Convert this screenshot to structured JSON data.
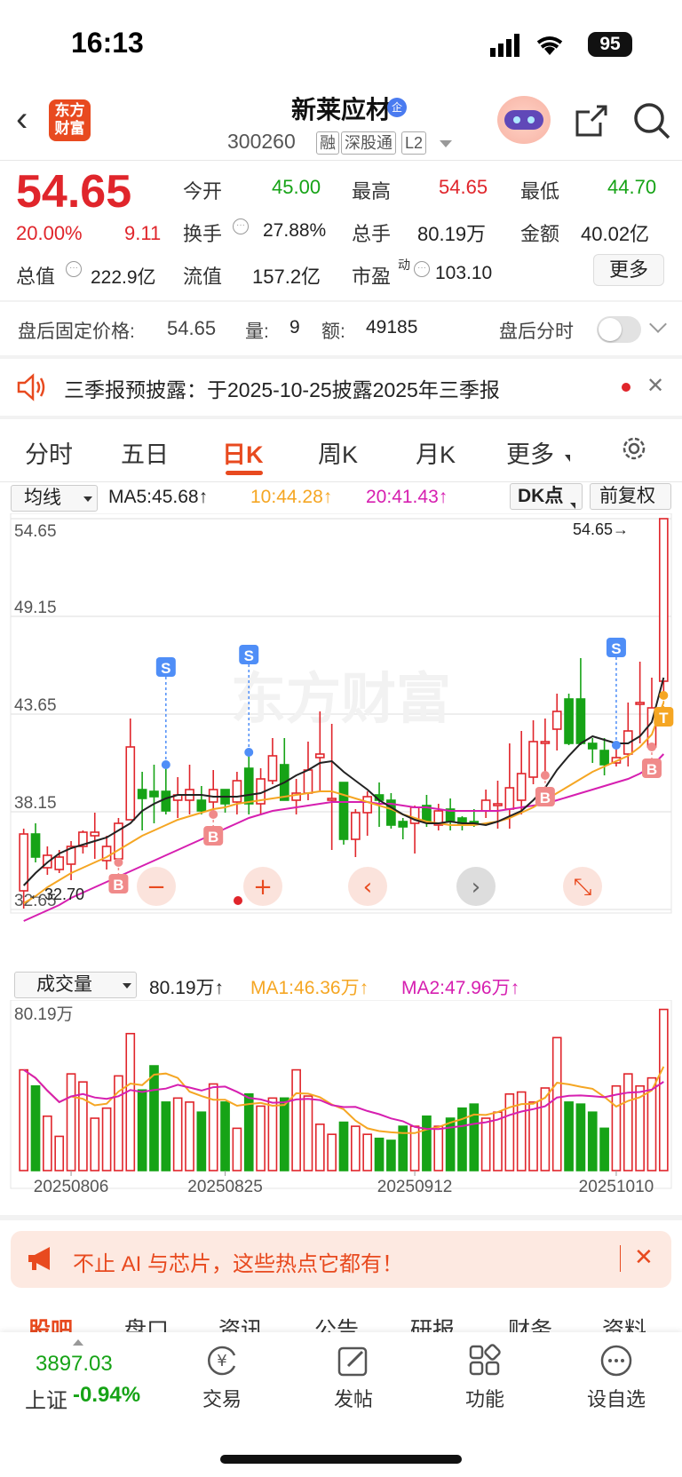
{
  "status": {
    "time": "16:13",
    "battery": "95"
  },
  "header": {
    "logo_line1": "东方",
    "logo_line2": "财富",
    "name": "新莱应材",
    "name_badge": "企",
    "code": "300260",
    "tags": [
      "融",
      "深股通",
      "L2"
    ]
  },
  "quote": {
    "price": "54.65",
    "change_pct": "20.00%",
    "change": "9.11",
    "open_label": "今开",
    "open": "45.00",
    "high_label": "最高",
    "high": "54.65",
    "low_label": "最低",
    "low": "44.70",
    "turnover_label": "换手",
    "turnover": "27.88%",
    "volume_label": "总手",
    "volume": "80.19万",
    "amount_label": "金额",
    "amount": "40.02亿",
    "mktcap_label": "总值",
    "mktcap": "222.9亿",
    "float_label": "流值",
    "float": "157.2亿",
    "pe_label": "市盈",
    "pe_sup": "动",
    "pe": "103.10",
    "more": "更多"
  },
  "afterhours": {
    "label": "盘后固定价格:",
    "price": "54.65",
    "vol_label": "量:",
    "vol": "9",
    "amt_label": "额:",
    "amt": "49185",
    "timeshare_label": "盘后分时"
  },
  "notice": {
    "text": "三季报预披露：于2025-10-25披露2025年三季报"
  },
  "tabs": [
    "分时",
    "五日",
    "日K",
    "周K",
    "月K",
    "更多"
  ],
  "active_tab": "日K",
  "ma_bar": {
    "select": "均线",
    "ma5": "MA5:45.68↑",
    "ma10": "10:44.28↑",
    "ma20": "20:41.43↑",
    "dk": "DK点",
    "adjust": "前复权"
  },
  "colors": {
    "up": "#e0252b",
    "down": "#16a316",
    "ma5": "#222222",
    "ma10": "#f5a623",
    "ma20": "#d61fb0",
    "accent": "#e84a1f"
  },
  "chart_data": [
    {
      "type": "candlestick",
      "y_ticks": [
        "54.65",
        "49.15",
        "43.65",
        "38.15",
        "32.65"
      ],
      "ylim": [
        32.65,
        54.65
      ],
      "last_price_label": "54.65→",
      "low_marker": "32.70",
      "watermark": "东方财富",
      "candles": [
        [
          33.7,
          36.9,
          32.7,
          37.2
        ],
        [
          36.9,
          35.6,
          35.3,
          37.5
        ],
        [
          35.0,
          35.7,
          34.6,
          36.2
        ],
        [
          34.9,
          35.6,
          34.7,
          36.0
        ],
        [
          35.2,
          36.2,
          34.3,
          36.5
        ],
        [
          36.2,
          37.0,
          35.8,
          37.1
        ],
        [
          36.8,
          37.0,
          35.5,
          38.1
        ],
        [
          35.4,
          36.2,
          34.9,
          36.8
        ],
        [
          35.5,
          37.5,
          35.3,
          37.8
        ],
        [
          37.7,
          41.8,
          37.7,
          43.4
        ],
        [
          39.4,
          38.9,
          37.1,
          40.4
        ],
        [
          39.3,
          39.0,
          37.5,
          40.8
        ],
        [
          39.3,
          38.2,
          38.0,
          40.8
        ],
        [
          38.8,
          39.1,
          37.8,
          40.1
        ],
        [
          38.8,
          39.4,
          38.0,
          40.8
        ],
        [
          38.8,
          38.2,
          38.0,
          39.6
        ],
        [
          38.7,
          39.4,
          38.0,
          40.5
        ],
        [
          39.4,
          38.6,
          38.1,
          39.4
        ],
        [
          38.7,
          39.9,
          38.0,
          40.4
        ],
        [
          40.6,
          38.6,
          38.0,
          41.5
        ],
        [
          38.6,
          40.0,
          38.0,
          40.6
        ],
        [
          39.9,
          41.3,
          39.7,
          42.3
        ],
        [
          40.8,
          38.8,
          38.8,
          42.3
        ],
        [
          38.8,
          39.2,
          38.0,
          40.0
        ],
        [
          39.2,
          40.5,
          38.8,
          42.1
        ],
        [
          41.2,
          41.4,
          39.3,
          43.8
        ],
        [
          38.8,
          38.9,
          36.0,
          43.1
        ],
        [
          39.8,
          36.6,
          36.3,
          39.8
        ],
        [
          36.6,
          38.1,
          35.6,
          38.3
        ],
        [
          38.1,
          39.0,
          36.8,
          39.3
        ],
        [
          39.1,
          38.8,
          37.3,
          39.8
        ],
        [
          38.8,
          37.4,
          37.2,
          39.2
        ],
        [
          37.6,
          37.3,
          36.6,
          37.8
        ],
        [
          37.5,
          38.4,
          35.8,
          38.5
        ],
        [
          38.5,
          37.6,
          37.3,
          39.1
        ],
        [
          37.4,
          38.2,
          37.1,
          38.6
        ],
        [
          38.3,
          37.6,
          37.1,
          38.9
        ],
        [
          37.8,
          37.5,
          37.1,
          37.9
        ],
        [
          37.6,
          37.5,
          37.3,
          38.3
        ],
        [
          38.2,
          38.8,
          37.8,
          39.4
        ],
        [
          38.5,
          38.6,
          37.2,
          39.9
        ],
        [
          38.3,
          39.5,
          37.2,
          42.0
        ],
        [
          38.8,
          40.3,
          38.0,
          42.7
        ],
        [
          40.1,
          42.1,
          39.7,
          43.3
        ],
        [
          42.1,
          42.1,
          40.2,
          43.4
        ],
        [
          42.8,
          43.8,
          41.6,
          44.8
        ],
        [
          44.5,
          42.0,
          41.9,
          44.8
        ],
        [
          44.5,
          42.0,
          41.9,
          46.8
        ],
        [
          42.0,
          41.7,
          40.9,
          42.3
        ],
        [
          41.6,
          40.8,
          40.2,
          42.3
        ],
        [
          40.9,
          41.2,
          40.7,
          41.9
        ],
        [
          41.4,
          42.7,
          40.7,
          44.3
        ],
        [
          44.3,
          44.3,
          42.0,
          46.6
        ],
        [
          41.8,
          44.0,
          41.8,
          45.7
        ],
        [
          45.5,
          54.65,
          44.7,
          54.65
        ]
      ],
      "ma5": [
        34.0,
        34.7,
        35.3,
        35.8,
        36.1,
        36.3,
        36.5,
        36.7,
        37.1,
        37.5,
        38.2,
        38.6,
        38.9,
        39.1,
        39.1,
        39.1,
        39.0,
        39.0,
        39.0,
        39.1,
        39.2,
        39.5,
        39.8,
        40.2,
        40.5,
        40.9,
        41.0,
        40.4,
        39.9,
        39.4,
        38.8,
        38.4,
        38.0,
        37.7,
        37.5,
        37.5,
        37.6,
        37.5,
        37.5,
        37.4,
        37.6,
        37.9,
        38.2,
        38.8,
        39.5,
        40.5,
        41.3,
        42.0,
        42.4,
        42.2,
        42.0,
        42.0,
        42.4,
        43.2,
        45.7
      ],
      "ma10": [
        33.0,
        33.4,
        33.9,
        34.3,
        34.7,
        35.0,
        35.3,
        35.6,
        36.0,
        36.4,
        36.8,
        37.1,
        37.4,
        37.7,
        37.9,
        38.1,
        38.3,
        38.4,
        38.6,
        38.7,
        38.8,
        38.9,
        39.0,
        39.1,
        39.2,
        39.3,
        39.3,
        39.1,
        38.9,
        38.7,
        38.5,
        38.3,
        38.0,
        37.8,
        37.6,
        37.5,
        37.4,
        37.4,
        37.4,
        37.5,
        37.6,
        37.8,
        38.1,
        38.4,
        38.8,
        39.2,
        39.6,
        40.0,
        40.4,
        40.7,
        41.0,
        41.3,
        41.8,
        42.5,
        44.3
      ],
      "ma20": [
        32.0,
        32.3,
        32.6,
        32.9,
        33.3,
        33.6,
        33.9,
        34.2,
        34.5,
        34.8,
        35.1,
        35.4,
        35.7,
        36.0,
        36.3,
        36.6,
        36.9,
        37.2,
        37.5,
        37.8,
        38.0,
        38.2,
        38.3,
        38.4,
        38.5,
        38.6,
        38.7,
        38.7,
        38.7,
        38.7,
        38.6,
        38.6,
        38.5,
        38.4,
        38.4,
        38.3,
        38.2,
        38.2,
        38.2,
        38.2,
        38.2,
        38.3,
        38.4,
        38.5,
        38.6,
        38.8,
        39.0,
        39.2,
        39.4,
        39.6,
        39.8,
        40.0,
        40.3,
        40.7,
        41.4
      ],
      "signals": [
        {
          "label": "B",
          "index": 8,
          "kind": "buy"
        },
        {
          "label": "B",
          "index": 16,
          "kind": "buy"
        },
        {
          "label": "B",
          "index": 44,
          "kind": "buy"
        },
        {
          "label": "B",
          "index": 53,
          "kind": "buy"
        },
        {
          "label": "T",
          "index": 54,
          "kind": "t"
        },
        {
          "label": "S",
          "index": 12,
          "kind": "sell"
        },
        {
          "label": "S",
          "index": 19,
          "kind": "sell"
        },
        {
          "label": "S",
          "index": 50,
          "kind": "sell"
        },
        {
          "label": "S",
          "index": 57,
          "kind": "sell"
        }
      ],
      "controls": [
        "−",
        "+",
        "‹",
        "›",
        "⤡"
      ]
    },
    {
      "type": "bar",
      "title": "成交量",
      "current": "80.19万↑",
      "ma1": "MA1:46.36万↑",
      "ma2": "MA2:47.96万↑",
      "top_label": "80.19万",
      "x_labels": [
        "20250806",
        "20250825",
        "20250912",
        "20251010"
      ],
      "volumes": [
        50,
        42,
        27,
        17,
        48,
        44,
        26,
        31,
        47,
        68,
        40,
        52,
        34,
        36,
        34,
        29,
        43,
        34,
        21,
        38,
        32,
        36,
        36,
        50,
        37,
        23,
        18,
        24,
        22,
        18,
        16,
        15,
        22,
        22,
        27,
        22,
        26,
        31,
        33,
        26,
        29,
        38,
        39,
        34,
        41,
        66,
        34,
        33,
        29,
        21,
        42,
        48,
        42,
        46,
        80
      ]
    }
  ],
  "promo": {
    "text": "不止 AI 与芯片，这些热点它都有！"
  },
  "subtabs": [
    "股吧",
    "盘口",
    "资讯",
    "公告",
    "研报",
    "财务",
    "资料"
  ],
  "bottom_nav": {
    "index_value": "3897.03",
    "index_name": "上证",
    "index_change": "-0.94%",
    "items": [
      "交易",
      "发帖",
      "功能",
      "设自选"
    ]
  }
}
